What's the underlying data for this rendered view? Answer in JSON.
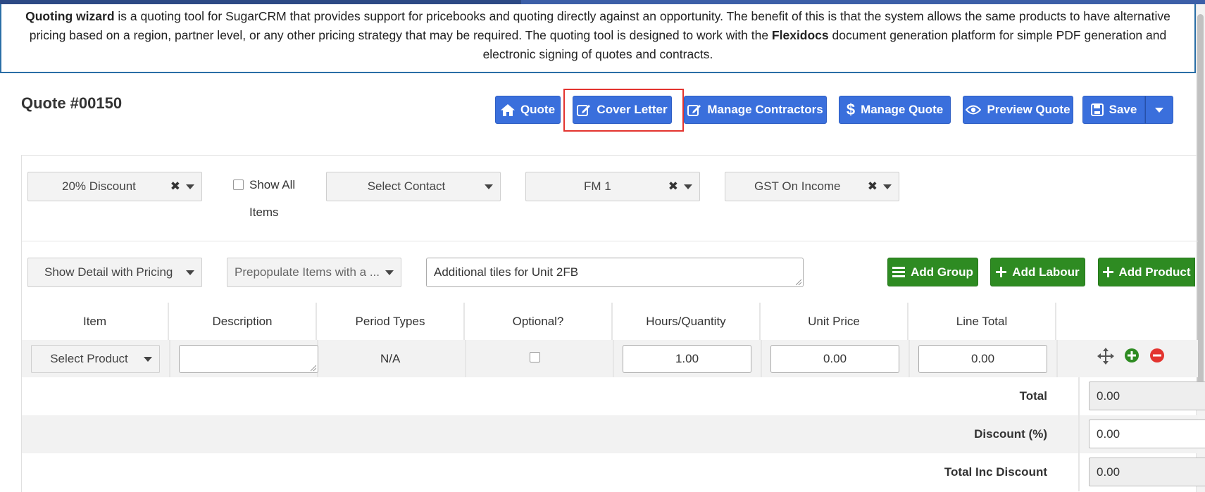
{
  "info": {
    "part1_bold": "Quoting wizard",
    "part2": " is a quoting tool for SugarCRM that provides support for pricebooks and quoting directly against an opportunity. The benefit of this is that the system allows the same products to have alternative pricing based on a region, partner level, or any other pricing strategy that may be required. The quoting tool is designed to work with the ",
    "part3_bold": "Flexidocs",
    "part4": " document generation platform for simple PDF generation and electronic signing of quotes and contracts."
  },
  "quote": {
    "title": "Quote #00150"
  },
  "toolbar": {
    "quote": "Quote",
    "cover_letter": "Cover Letter",
    "manage_contractors": "Manage Contractors",
    "manage_quote": "Manage Quote",
    "preview_quote": "Preview Quote",
    "save": "Save"
  },
  "filters": {
    "discount": "20% Discount",
    "show_all_items": "Show All Items",
    "show_all_line1": "Show All",
    "show_all_line2": "Items",
    "contact": "Select Contact",
    "fm": "FM 1",
    "tax": "GST On Income"
  },
  "options": {
    "detail": "Show Detail with Pricing",
    "prepopulate": "Prepopulate Items with a ...",
    "group_name": "Additional tiles for Unit 2FB",
    "add_group": "Add Group",
    "add_labour": "Add Labour",
    "add_product": "Add Product"
  },
  "table": {
    "headers": [
      "Item",
      "Description",
      "Period Types",
      "Optional?",
      "Hours/Quantity",
      "Unit Price",
      "Line Total"
    ],
    "row": {
      "item": "Select Product",
      "description": "",
      "period": "N/A",
      "quantity": "1.00",
      "unit_price": "0.00",
      "line_total": "0.00"
    }
  },
  "totals": {
    "total_label": "Total",
    "total_value": "0.00",
    "discount_label": "Discount (%)",
    "discount_value": "0.00",
    "inc_discount_label": "Total Inc Discount",
    "inc_discount_value": "0.00"
  },
  "colors": {
    "primary_button": "#3a6fdc",
    "success_button": "#2e8b22",
    "highlight": "#e3342f",
    "info_border": "#2a6ea6"
  }
}
